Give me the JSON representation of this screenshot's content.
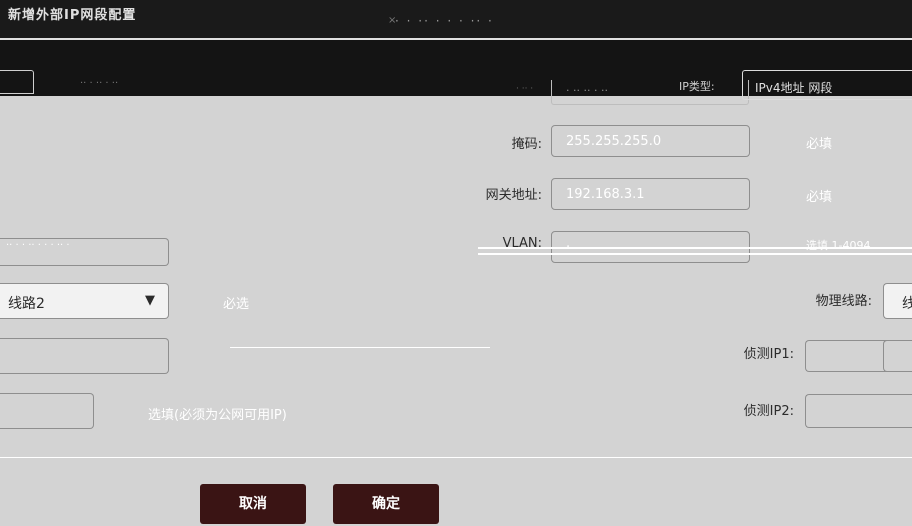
{
  "window": {
    "title": "新增外部IP网段配置",
    "center_title": "· · ·· ·  ·  · ·· ·",
    "close_symbol": "×"
  },
  "top": {
    "hint": "·· · ·· ·  ··",
    "small_label": "· ·· ·",
    "ip_value": "·  ·· ·· · ··",
    "type_label": "IP类型:",
    "type_value": "IPv4地址 网段"
  },
  "form": {
    "mask_label": "掩码:",
    "mask_value": "255.255.255.0",
    "mask_note": "必填",
    "gateway_label": "网关地址:",
    "gateway_value": "192.168.3.1",
    "gateway_note": "必填",
    "vlan_label": "VLAN:",
    "vlan_value": "·",
    "vlan_note": "选填 1-4094",
    "left_row1_hint": "·· · · ·· · ·  · ·· ·",
    "line_label": "线路2",
    "line_note": "必选",
    "phys_label": "物理线路:",
    "phys_value": "线",
    "detect1_label": "侦测IP1:",
    "detect2_label": "侦测IP2:",
    "detect_note": "选填(必须为公网可用IP)"
  },
  "buttons": {
    "cancel": "取消",
    "ok": "确定"
  }
}
